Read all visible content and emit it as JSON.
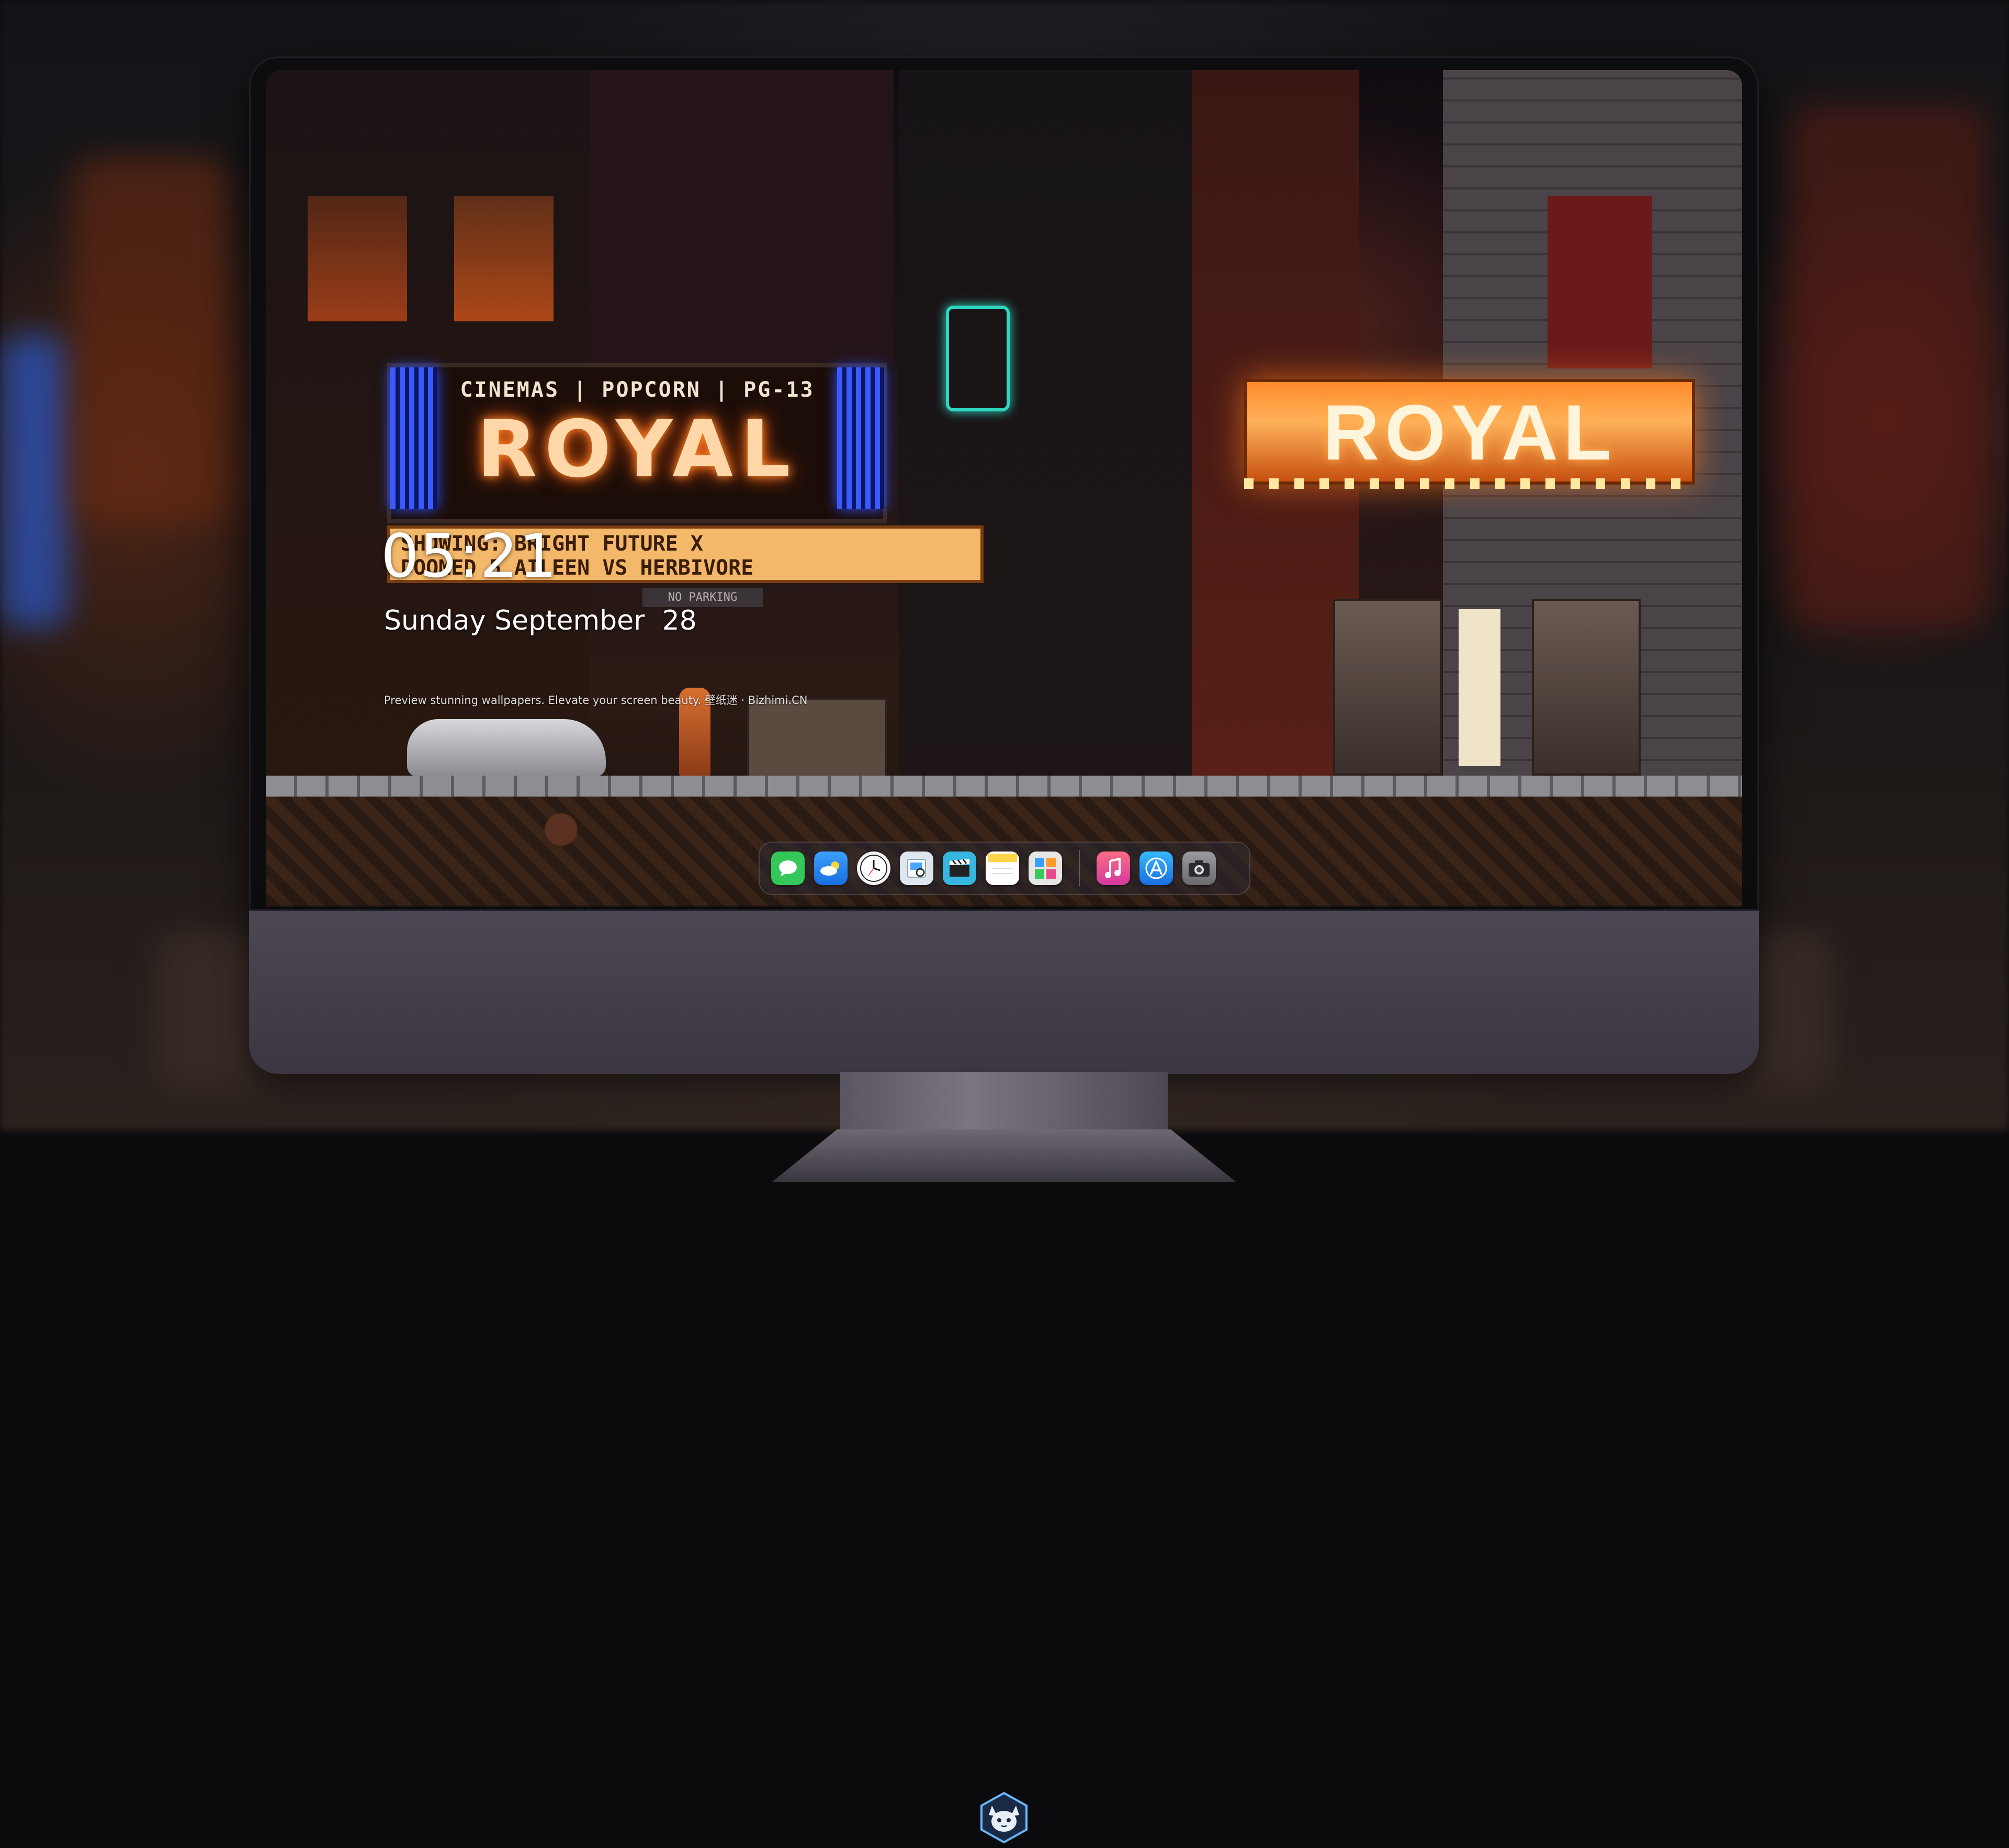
{
  "lockscreen": {
    "time": "05:21",
    "date": "Sunday September  28",
    "caption": "Preview stunning wallpapers. Elevate your screen beauty. 壁纸迷 · Bizhimi.CN"
  },
  "wallpaper": {
    "left_marquee_topline": "CINEMAS | POPCORN | PG-13",
    "left_marquee_title": "ROYAL",
    "showing_line1": "SHOWING: BRIGHT FUTURE X",
    "showing_line2": "DOOMED 5   AILEEN VS HERBIVORE",
    "right_marquee_title": "ROYAL",
    "no_parking": "NO PARKING"
  },
  "dock": {
    "apps": [
      {
        "name": "messages-icon",
        "color": "#34c759"
      },
      {
        "name": "weather-icon",
        "color": "#2f8bff"
      },
      {
        "name": "clock-icon",
        "color": "#f4f4f4"
      },
      {
        "name": "preview-icon",
        "color": "#dfe6ef"
      },
      {
        "name": "final-cut-icon",
        "color": "#37b7e0"
      },
      {
        "name": "notes-icon",
        "color": "#ffd54a"
      },
      {
        "name": "photo-booth-icon",
        "color": "#e6e6e6"
      },
      {
        "name": "music-icon",
        "color": "#fb5c74"
      },
      {
        "name": "app-store-icon",
        "color": "#1d8cf8"
      },
      {
        "name": "camera-icon",
        "color": "#8a8a8f"
      }
    ]
  },
  "colors": {
    "neon_orange": "#ff8a2a",
    "neon_blue": "#3a5aff",
    "monitor_chin": "#46404c"
  }
}
